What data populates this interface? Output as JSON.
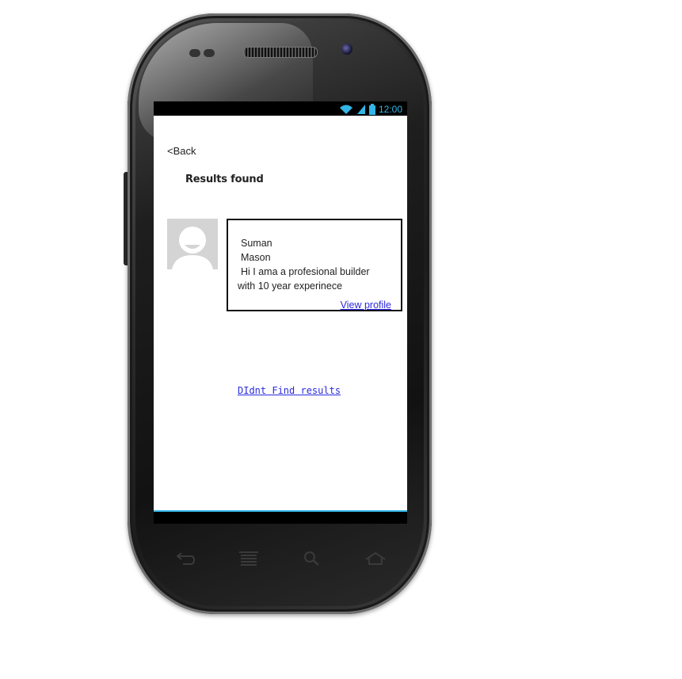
{
  "status_bar": {
    "time": "12:00",
    "icons": [
      "wifi-icon",
      "signal-icon",
      "battery-icon"
    ],
    "accent_color": "#33b5e5"
  },
  "header": {
    "back_label": "<Back",
    "title": "Results found"
  },
  "results": [
    {
      "avatar": "avatar-placeholder",
      "first_name": "Suman",
      "last_name": "Mason",
      "bio_line1": "Hi I ama a profesional builder",
      "bio_line2": "with 10 year experinece",
      "link_label": "View profile"
    }
  ],
  "footer_link": "DIdnt Find results",
  "nav_buttons": [
    "back-nav-icon",
    "recent-apps-icon",
    "search-nav-icon",
    "home-nav-icon"
  ],
  "colors": {
    "link": "#2a2ae0",
    "frame": "#1c1c1c"
  }
}
